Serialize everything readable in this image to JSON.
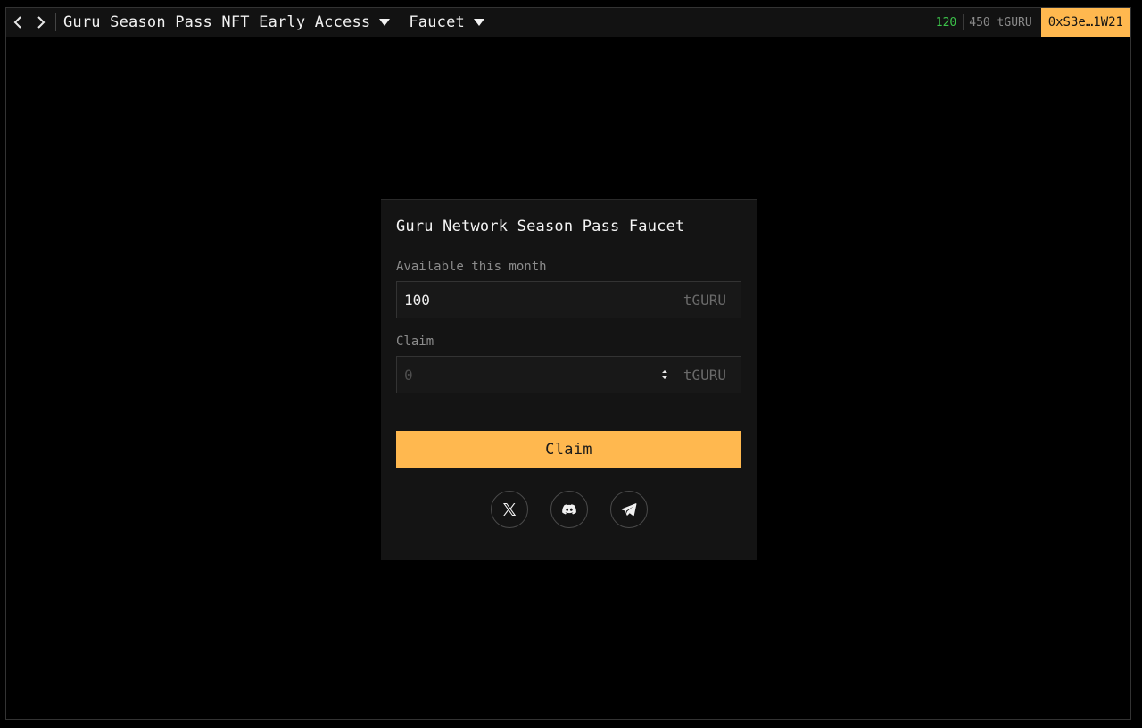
{
  "topbar": {
    "breadcrumb_project": "Guru Season Pass NFT Early Access",
    "breadcrumb_page": "Faucet",
    "stat_primary": "120",
    "stat_balance": "450 tGURU",
    "wallet": "0xS3e…1W21",
    "icons": [
      "chevron-left-icon",
      "chevron-right-icon",
      "caret-down-icon"
    ]
  },
  "card": {
    "title": "Guru Network Season Pass Faucet",
    "available_label": "Available this month",
    "available_value": "100",
    "available_unit": "tGURU",
    "claim_label": "Claim",
    "claim_placeholder": "0",
    "claim_unit": "tGURU",
    "claim_button": "Claim",
    "socials": [
      "x-icon",
      "discord-icon",
      "telegram-icon"
    ]
  },
  "colors": {
    "accent": "#ffb84f",
    "positive": "#3cc24a",
    "background": "#000000",
    "panel": "#141414"
  }
}
